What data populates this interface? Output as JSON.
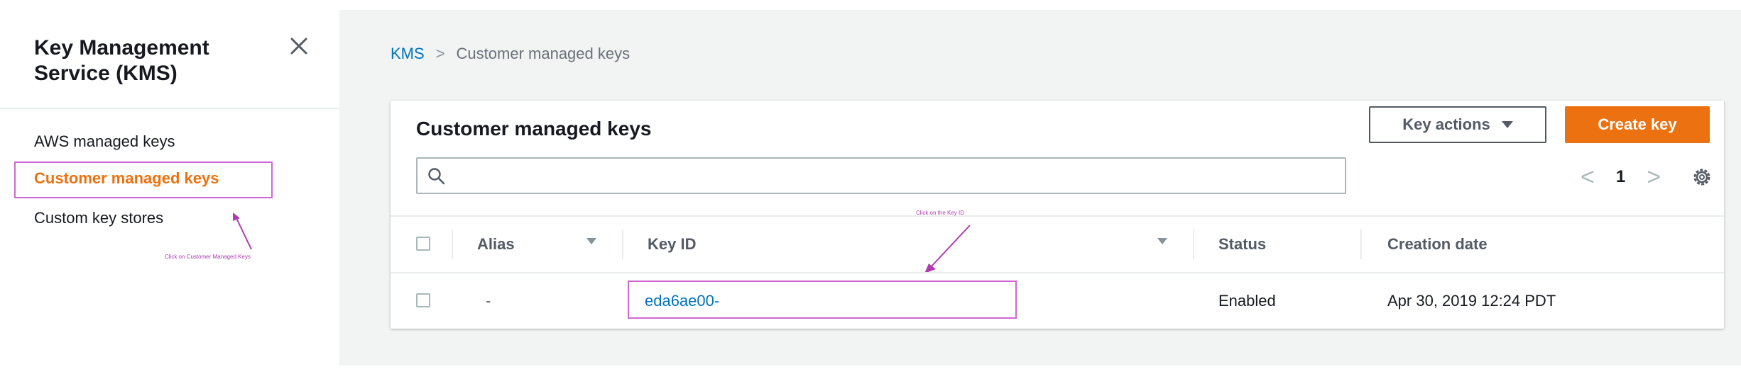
{
  "sidebar": {
    "title_line1": "Key Management",
    "title_line2": "Service (KMS)",
    "items": [
      {
        "label": "AWS managed keys",
        "active": false
      },
      {
        "label": "Customer managed keys",
        "active": true
      },
      {
        "label": "Custom key stores",
        "active": false
      }
    ],
    "annotation": "Click on Customer Managed Keys"
  },
  "breadcrumb": {
    "root": "KMS",
    "separator": ">",
    "current": "Customer managed keys"
  },
  "panel": {
    "title": "Customer managed keys",
    "key_actions_label": "Key actions",
    "create_key_label": "Create key",
    "search": {
      "value": "",
      "placeholder": ""
    },
    "pagination": {
      "current_page": "1",
      "prev": "<",
      "next": ">"
    }
  },
  "table": {
    "columns": [
      "Alias",
      "Key ID",
      "Status",
      "Creation date"
    ],
    "rows": [
      {
        "alias": "-",
        "key_id": "eda6ae00-",
        "status": "Enabled",
        "creation_date": "Apr 30, 2019 12:24 PDT"
      }
    ]
  },
  "annotations": {
    "key_id_hint": "Click on the Key ID"
  },
  "colors": {
    "accent_orange": "#ec7211",
    "link_blue": "#0073bb",
    "annotation_magenta": "#d166d1",
    "main_background": "#f2f3f3"
  },
  "icons": {
    "close": "close-icon",
    "dropdown": "caret-down-icon",
    "search": "search-icon",
    "settings": "gear-icon",
    "sort": "sort-down-icon"
  }
}
